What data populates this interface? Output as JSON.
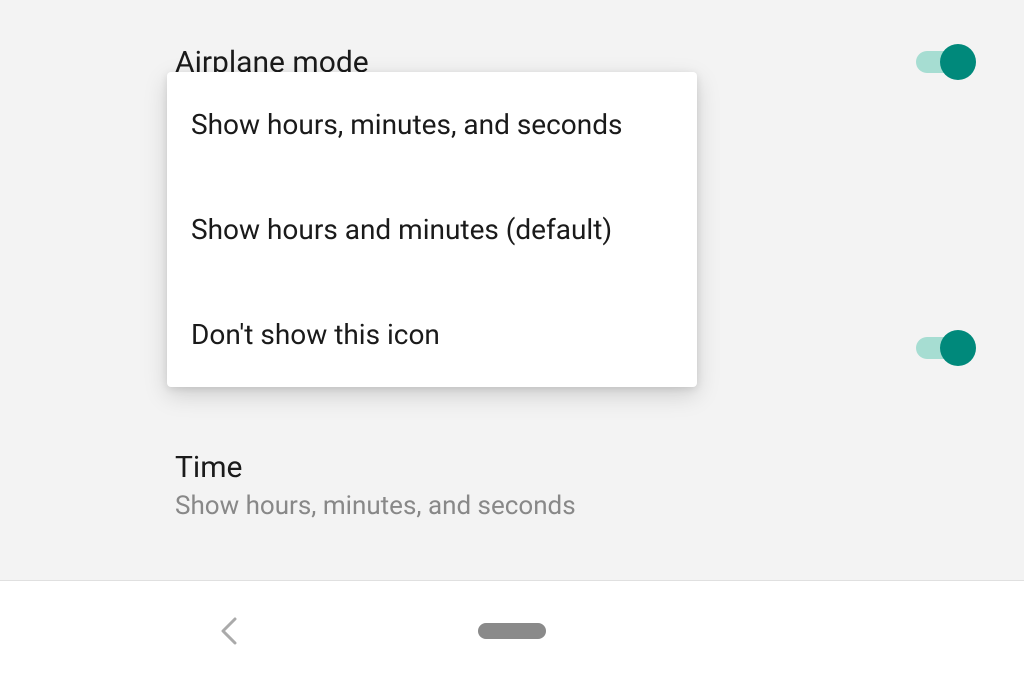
{
  "settings": {
    "airplane_mode_label": "Airplane mode",
    "toggle_1_on": true,
    "toggle_2_on": true
  },
  "popup": {
    "options": [
      {
        "label": "Show hours, minutes, and seconds"
      },
      {
        "label": "Show hours and minutes (default)"
      },
      {
        "label": "Don't show this icon"
      }
    ]
  },
  "time_section": {
    "title": "Time",
    "subtitle": "Show hours, minutes, and seconds"
  },
  "nav": {
    "back": "back",
    "home": "home"
  }
}
